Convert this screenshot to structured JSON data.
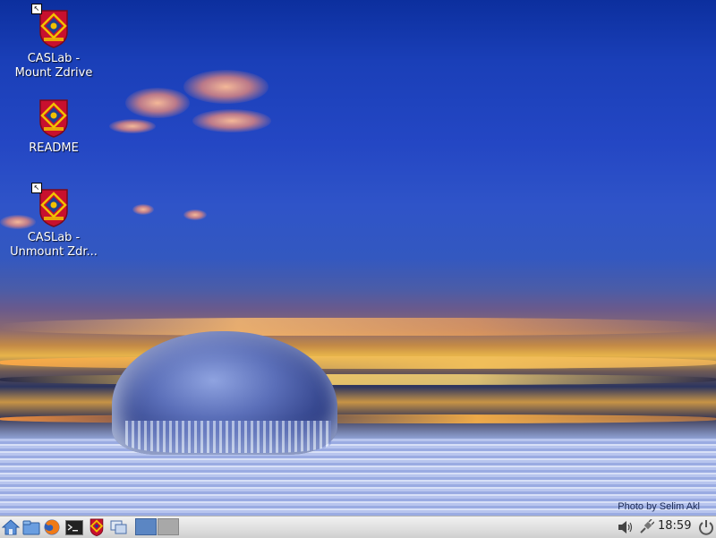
{
  "desktop": {
    "icons": [
      {
        "label": "CASLab -\nMount Zdrive",
        "icon": "queens-crest-icon",
        "shortcut": true
      },
      {
        "label": "README",
        "icon": "queens-crest-icon",
        "shortcut": false
      },
      {
        "label": "CASLab -\nUnmount Zdr...",
        "icon": "queens-crest-icon",
        "shortcut": true
      }
    ],
    "photo_credit": "Photo by Selim Akl"
  },
  "taskbar": {
    "launchers": [
      {
        "name": "home-folder-icon"
      },
      {
        "name": "file-manager-icon"
      },
      {
        "name": "firefox-icon"
      },
      {
        "name": "terminal-icon"
      },
      {
        "name": "queens-crest-icon"
      },
      {
        "name": "window-switcher-icon"
      }
    ],
    "pager": {
      "desktops": 2,
      "active": 1
    },
    "tray": {
      "volume_icon": "speaker-icon",
      "network_icon": "network-plug-icon",
      "clock": "18:59",
      "power_icon": "power-icon"
    }
  },
  "colors": {
    "sky_top": "#0c2f9e",
    "sunset_band": "#e7b44a",
    "taskbar": "#dedede",
    "crest_red": "#c8102e",
    "crest_gold": "#f2c100",
    "crest_blue": "#1f3f8f"
  }
}
